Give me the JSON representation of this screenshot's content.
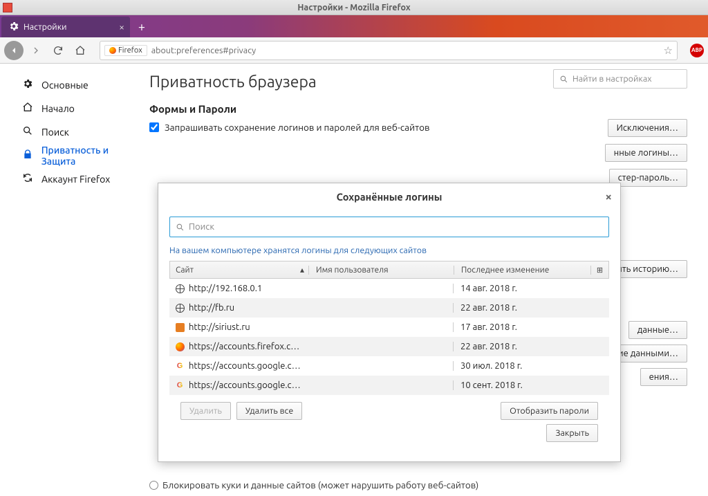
{
  "window": {
    "title": "Настройки - Mozilla Firefox"
  },
  "tabs": {
    "active": "Настройки"
  },
  "urlbar": {
    "identity": "Firefox",
    "url": "about:preferences#privacy"
  },
  "search_settings": {
    "placeholder": "Найти в настройках"
  },
  "sidebar": {
    "items": [
      {
        "label": "Основные"
      },
      {
        "label": "Начало"
      },
      {
        "label": "Поиск"
      },
      {
        "label": "Приватность и Защита"
      },
      {
        "label": "Аккаунт Firefox"
      }
    ]
  },
  "page": {
    "title": "Приватность браузера",
    "forms_section": "Формы и Пароли",
    "ask_save": "Запрашивать сохранение логинов и паролей для веб-сайтов",
    "btn_exceptions": "Исключения…",
    "btn_saved": "нные логины…",
    "btn_master": "стер-пароль…",
    "btn_clear_hist": "ить историю…",
    "btn_data": "данные…",
    "btn_manage_data": "ние данными…",
    "btn_perms": "ения…",
    "block_cookies": "Блокировать куки и данные сайтов (может нарушить работу веб-сайтов)"
  },
  "dialog": {
    "title": "Сохранённые логины",
    "search_placeholder": "Поиск",
    "info": "На вашем компьютере хранятся логины для следующих сайтов",
    "col_site": "Сайт",
    "col_user": "Имя пользователя",
    "col_changed": "Последнее изменение",
    "rows": [
      {
        "icon": "globe",
        "site": "http://192.168.0.1",
        "changed": "14 авг. 2018 г."
      },
      {
        "icon": "globe",
        "site": "http://fb.ru",
        "changed": "22 авг. 2018 г."
      },
      {
        "icon": "orange",
        "site": "http://siriust.ru",
        "changed": "17 авг. 2018 г."
      },
      {
        "icon": "firefox",
        "site": "https://accounts.firefox.c…",
        "changed": "22 авг. 2018 г."
      },
      {
        "icon": "google",
        "site": "https://accounts.google.c…",
        "changed": "30 июл. 2018 г."
      },
      {
        "icon": "google",
        "site": "https://accounts.google.c…",
        "changed": "10 сент. 2018 г."
      }
    ],
    "btn_delete": "Удалить",
    "btn_delete_all": "Удалить все",
    "btn_show": "Отобразить пароли",
    "btn_close": "Закрыть"
  }
}
